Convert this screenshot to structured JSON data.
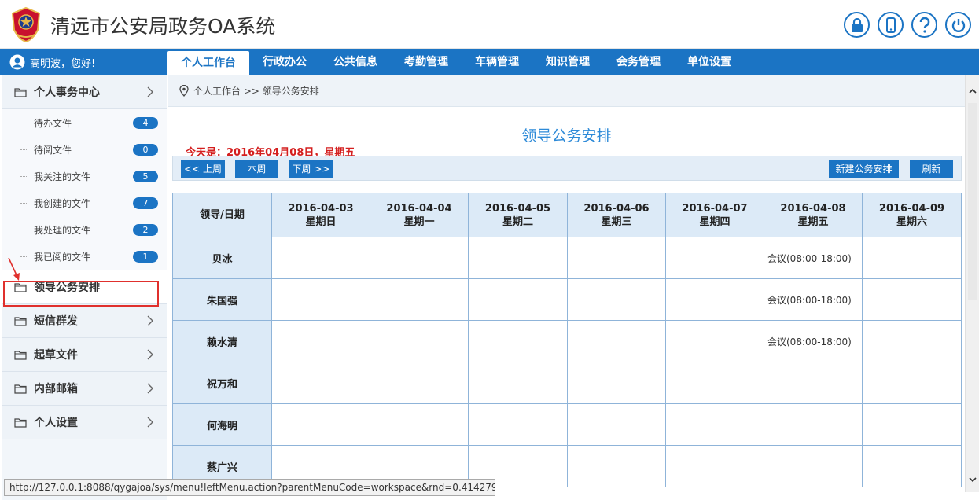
{
  "header": {
    "title": "清远市公安局政务OA系统",
    "icons": [
      "lock-icon",
      "phone-icon",
      "help-icon",
      "power-icon"
    ]
  },
  "user": {
    "greeting": "高明波，您好!"
  },
  "topnav": {
    "tabs": [
      {
        "label": "个人工作台",
        "active": true
      },
      {
        "label": "行政办公"
      },
      {
        "label": "公共信息"
      },
      {
        "label": "考勤管理"
      },
      {
        "label": "车辆管理"
      },
      {
        "label": "知识管理"
      },
      {
        "label": "会务管理"
      },
      {
        "label": "单位设置"
      }
    ]
  },
  "sidebar": {
    "personal_center": "个人事务中心",
    "items": [
      {
        "label": "待办文件",
        "count": "4"
      },
      {
        "label": "待阅文件",
        "count": "0"
      },
      {
        "label": "我关注的文件",
        "count": "5"
      },
      {
        "label": "我创建的文件",
        "count": "7"
      },
      {
        "label": "我处理的文件",
        "count": "2"
      },
      {
        "label": "我已阅的文件",
        "count": "1"
      }
    ],
    "leader_schedule": "领导公务安排",
    "sms": "短信群发",
    "draft": "起草文件",
    "mail": "内部邮箱",
    "settings": "个人设置"
  },
  "content": {
    "breadcrumb": "个人工作台 >> 领导公务安排",
    "title": "领导公务安排",
    "today": "今天是：2016年04月08日，星期五",
    "buttons": {
      "prev": "<< 上周",
      "current": "本周",
      "next": "下周 >>",
      "new": "新建公务安排",
      "refresh": "刷新"
    },
    "table": {
      "corner": "领导/日期",
      "days": [
        {
          "date": "2016-04-03",
          "weekday": "星期日"
        },
        {
          "date": "2016-04-04",
          "weekday": "星期一"
        },
        {
          "date": "2016-04-05",
          "weekday": "星期二"
        },
        {
          "date": "2016-04-06",
          "weekday": "星期三"
        },
        {
          "date": "2016-04-07",
          "weekday": "星期四"
        },
        {
          "date": "2016-04-08",
          "weekday": "星期五"
        },
        {
          "date": "2016-04-09",
          "weekday": "星期六"
        }
      ],
      "rows": [
        {
          "leader": "贝冰",
          "cells": [
            "",
            "",
            "",
            "",
            "",
            "会议(08:00-18:00)",
            ""
          ]
        },
        {
          "leader": "朱国强",
          "cells": [
            "",
            "",
            "",
            "",
            "",
            "会议(08:00-18:00)",
            ""
          ]
        },
        {
          "leader": "赖水清",
          "cells": [
            "",
            "",
            "",
            "",
            "",
            "会议(08:00-18:00)",
            ""
          ]
        },
        {
          "leader": "祝万和",
          "cells": [
            "",
            "",
            "",
            "",
            "",
            "",
            ""
          ]
        },
        {
          "leader": "何海明",
          "cells": [
            "",
            "",
            "",
            "",
            "",
            "",
            ""
          ]
        },
        {
          "leader": "蔡广兴",
          "cells": [
            "",
            "",
            "",
            "",
            "",
            "",
            ""
          ]
        }
      ]
    }
  },
  "statusbar": {
    "url": "http://127.0.0.1:8088/qygajoa/sys/menu!leftMenu.action?parentMenuCode=workspace&rnd=0.4142796..."
  }
}
